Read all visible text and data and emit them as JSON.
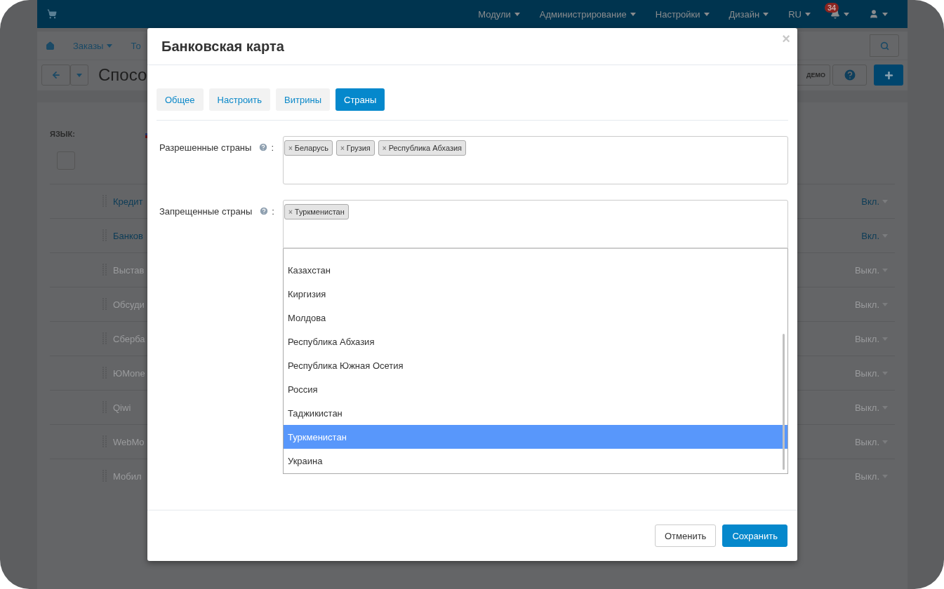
{
  "navbar": {
    "items": [
      {
        "label": "Модули"
      },
      {
        "label": "Администрирование"
      },
      {
        "label": "Настройки"
      },
      {
        "label": "Дизайн"
      },
      {
        "label": "RU"
      }
    ],
    "notifications_badge": "34"
  },
  "subnav": {
    "items": [
      "Заказы",
      "То"
    ]
  },
  "toolbar": {
    "title": "Спосо",
    "demo": "ДЕМО"
  },
  "panel": {
    "language_label": "ЯЗЫК:",
    "select_all_checked": false,
    "rows": [
      {
        "name": "Кредит",
        "status": "Вкл.",
        "active": true
      },
      {
        "name": "Банков",
        "status": "Вкл.",
        "active": true
      },
      {
        "name": "Выстав",
        "status": "Выкл.",
        "active": false
      },
      {
        "name": "Обсуди",
        "status": "Выкл.",
        "active": false
      },
      {
        "name": "Сберба",
        "status": "Выкл.",
        "active": false
      },
      {
        "name": "ЮMone",
        "status": "Выкл.",
        "active": false
      },
      {
        "name": "Qiwi",
        "status": "Выкл.",
        "active": false
      },
      {
        "name": "WebMo",
        "status": "Выкл.",
        "active": false
      },
      {
        "name": "Мобил",
        "status": "Выкл.",
        "active": false
      }
    ]
  },
  "modal": {
    "title": "Банковская карта",
    "close": "×",
    "tabs": [
      {
        "label": "Общее",
        "selected": false
      },
      {
        "label": "Настроить",
        "selected": false
      },
      {
        "label": "Витрины",
        "selected": false
      },
      {
        "label": "Страны",
        "selected": true
      }
    ],
    "fields": [
      {
        "label": "Разрешенные страны",
        "colon": ":",
        "tags": [
          {
            "label": "Беларусь",
            "remove": "×"
          },
          {
            "label": "Грузия",
            "remove": "×"
          },
          {
            "label": "Республика Абхазия",
            "remove": "×"
          }
        ],
        "open": false
      },
      {
        "label": "Запрещенные страны",
        "colon": ":",
        "tags": [
          {
            "label": "Туркменистан",
            "remove": "×"
          }
        ],
        "open": true
      }
    ],
    "dropdown": {
      "options": [
        {
          "label": "Казахстан",
          "selected": false
        },
        {
          "label": "Киргизия",
          "selected": false
        },
        {
          "label": "Молдова",
          "selected": false
        },
        {
          "label": "Республика Абхазия",
          "selected": false
        },
        {
          "label": "Республика Южная Осетия",
          "selected": false
        },
        {
          "label": "Россия",
          "selected": false
        },
        {
          "label": "Таджикистан",
          "selected": false
        },
        {
          "label": "Туркменистан",
          "selected": true
        },
        {
          "label": "Украина",
          "selected": false
        }
      ]
    },
    "buttons": [
      {
        "label": "Отменить",
        "kind": "secondary"
      },
      {
        "label": "Сохранить",
        "kind": "primary"
      }
    ]
  }
}
